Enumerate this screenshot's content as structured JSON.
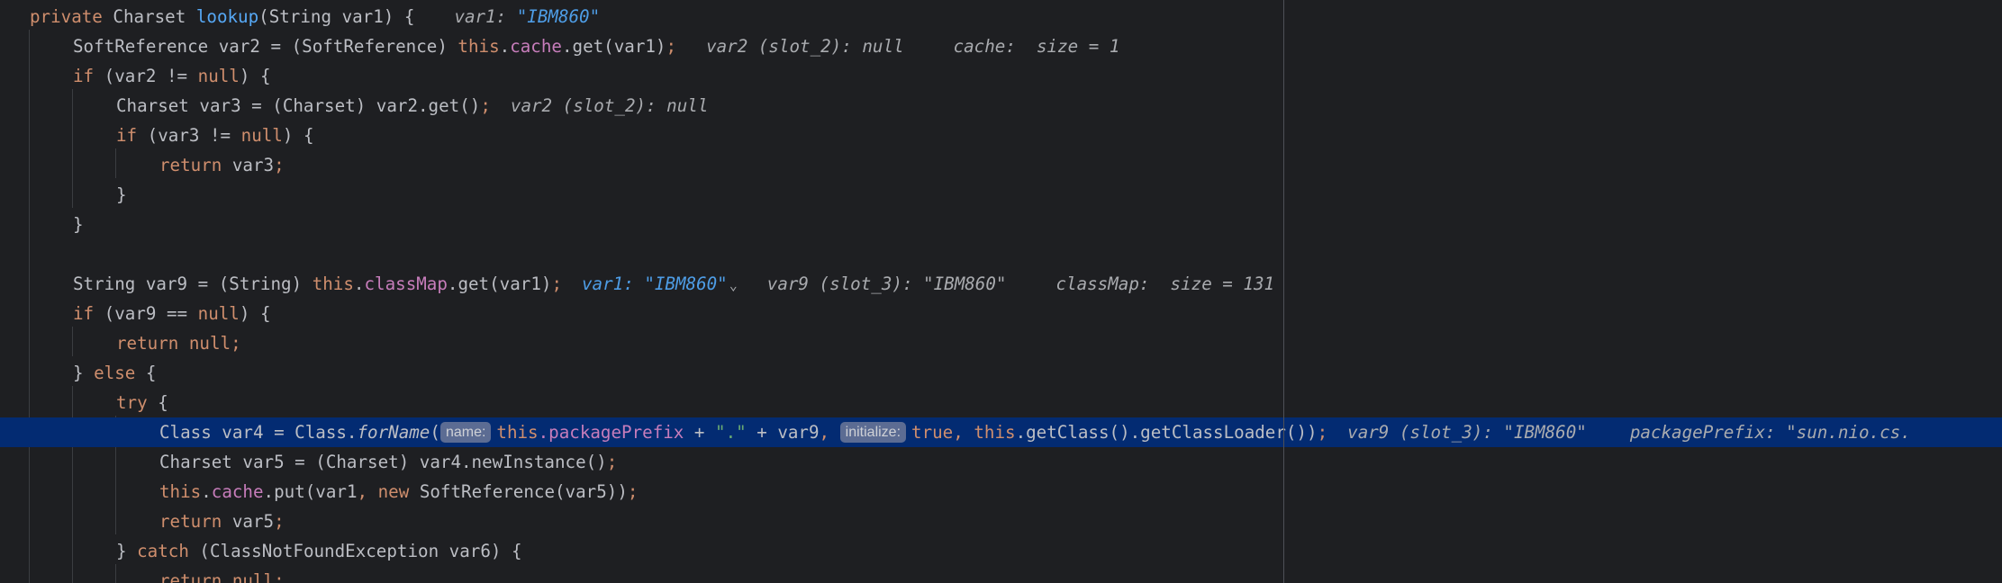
{
  "editor": {
    "lines": {
      "l1": {
        "kw_private": "private",
        "type": " Charset ",
        "method": "lookup",
        "sig": "(String var1) {",
        "hint_name": "var1: ",
        "hint_value": "\"IBM860\""
      },
      "l2": {
        "pre": "SoftReference var2 = (SoftReference) ",
        "kw_this": "this",
        "dot": ".",
        "field": "cache",
        "rest": ".get(var1)",
        "semi": ";",
        "hint1": "var2 (slot_2): null",
        "hint2": "cache:  size = 1"
      },
      "l3": {
        "kw_if": "if",
        "mid": " (var2 != ",
        "kw_null": "null",
        "end": ") {"
      },
      "l4": {
        "code": "Charset var3 = (Charset) var2.get()",
        "semi": ";",
        "hint": "var2 (slot_2): null"
      },
      "l5": {
        "kw_if": "if",
        "mid": " (var3 != ",
        "kw_null": "null",
        "end": ") {"
      },
      "l6": {
        "kw_return": "return",
        "rest": " var3",
        "semi": ";"
      },
      "l7": {
        "brace": "}"
      },
      "l8": {
        "brace": "}"
      },
      "l10": {
        "pre": "String var9 = (String) ",
        "kw_this": "this",
        "dot": ".",
        "field": "classMap",
        "rest": ".get(var1)",
        "semi": ";",
        "hint1_name": "var1: ",
        "hint1_value": "\"IBM860\"",
        "chevron": "⌄",
        "hint2": "var9 (slot_3): \"IBM860\"",
        "hint3": "classMap:  size = 131"
      },
      "l11": {
        "kw_if": "if",
        "mid": " (var9 == ",
        "kw_null": "null",
        "end": ") {"
      },
      "l12": {
        "kw_return": "return",
        "sp": " ",
        "kw_null": "null",
        "semi": ";"
      },
      "l13": {
        "pre": "} ",
        "kw_else": "else",
        "end": " {"
      },
      "l14": {
        "kw_try": "try",
        "end": " {"
      },
      "l15": {
        "pre": "Class var4 = Class.",
        "static_call": "forName",
        "open": "(",
        "param1": "name:",
        "kw_this1": "this",
        "field1": ".packagePrefix",
        "plus1": " + ",
        "str_dot": "\".\"",
        "plus2": " + var9",
        "comma1": ", ",
        "param2": "initialize:",
        "kw_true": "true",
        "comma2": ", ",
        "kw_this2": "this",
        "rest": ".getClass().getClassLoader())",
        "semi": ";",
        "hint1": "var9 (slot_3): \"IBM860\"",
        "hint2": "packagePrefix: \"sun.nio.cs."
      },
      "l16": {
        "code": "Charset var5 = (Charset) var4.newInstance()",
        "semi": ";"
      },
      "l17": {
        "kw_this": "this",
        "dot": ".",
        "field": "cache",
        "mid": ".put(var1",
        "comma": ", ",
        "kw_new": "new",
        "rest": " SoftReference(var5))",
        "semi": ";"
      },
      "l18": {
        "kw_return": "return",
        "rest": " var5",
        "semi": ";"
      },
      "l19": {
        "pre": "} ",
        "kw_catch": "catch",
        "end": " (ClassNotFoundException var6) {"
      },
      "l20": {
        "kw_return": "return",
        "sp": " ",
        "kw_null": "null",
        "semi": ";"
      }
    }
  }
}
